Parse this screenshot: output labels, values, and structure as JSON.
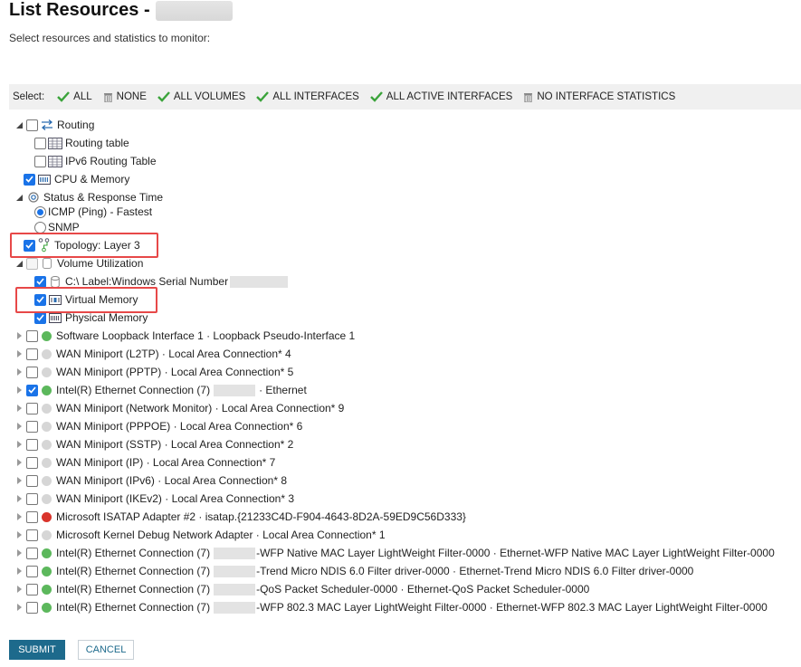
{
  "header": {
    "title": "List Resources -",
    "subtitle": "Select resources and statistics to monitor:"
  },
  "select_bar": {
    "label": "Select:",
    "buttons": [
      {
        "label": "ALL",
        "icon": "check-icon"
      },
      {
        "label": "NONE",
        "icon": "trash-icon"
      },
      {
        "label": "ALL VOLUMES",
        "icon": "check-icon"
      },
      {
        "label": "ALL INTERFACES",
        "icon": "check-icon"
      },
      {
        "label": "ALL ACTIVE INTERFACES",
        "icon": "check-icon"
      },
      {
        "label": "NO INTERFACE STATISTICS",
        "icon": "trash-icon"
      }
    ]
  },
  "tree": {
    "routing": {
      "label": "Routing",
      "checked": false
    },
    "routing_table": {
      "label": "Routing table",
      "checked": false
    },
    "ipv6_routing_table": {
      "label": "IPv6 Routing Table",
      "checked": false
    },
    "cpu_memory": {
      "label": "CPU & Memory",
      "checked": true
    },
    "status_response": {
      "label": "Status & Response Time"
    },
    "icmp": {
      "label": "ICMP (Ping) - Fastest",
      "selected": true
    },
    "snmp": {
      "label": "SNMP",
      "selected": false
    },
    "topology": {
      "label": "Topology: Layer 3",
      "checked": true
    },
    "volume_utilization": {
      "label": "Volume Utilization",
      "checked": false
    },
    "c_drive": {
      "label": "C:\\ Label:Windows Serial Number",
      "checked": true
    },
    "virtual_memory": {
      "label": "Virtual Memory",
      "checked": true
    },
    "physical_memory": {
      "label": "Physical Memory",
      "checked": true
    },
    "interfaces": [
      {
        "label": "Software Loopback Interface 1 · Loopback Pseudo-Interface 1",
        "status": "green",
        "checked": false
      },
      {
        "label": "WAN Miniport (L2TP) · Local Area Connection* 4",
        "status": "grey",
        "checked": false
      },
      {
        "label": "WAN Miniport (PPTP) · Local Area Connection* 5",
        "status": "grey",
        "checked": false
      },
      {
        "label": "Intel(R) Ethernet Connection (7)",
        "suffix": "· Ethernet",
        "status": "green",
        "checked": true,
        "redacted": true
      },
      {
        "label": "WAN Miniport (Network Monitor) · Local Area Connection* 9",
        "status": "grey",
        "checked": false
      },
      {
        "label": "WAN Miniport (PPPOE) · Local Area Connection* 6",
        "status": "grey",
        "checked": false
      },
      {
        "label": "WAN Miniport (SSTP) · Local Area Connection* 2",
        "status": "grey",
        "checked": false
      },
      {
        "label": "WAN Miniport (IP) · Local Area Connection* 7",
        "status": "grey",
        "checked": false
      },
      {
        "label": "WAN Miniport (IPv6) · Local Area Connection* 8",
        "status": "grey",
        "checked": false
      },
      {
        "label": "WAN Miniport (IKEv2) · Local Area Connection* 3",
        "status": "grey",
        "checked": false
      },
      {
        "label": "Microsoft ISATAP Adapter #2 · isatap.{21233C4D-F904-4643-8D2A-59ED9C56D333}",
        "status": "red",
        "checked": false
      },
      {
        "label": "Microsoft Kernel Debug Network Adapter · Local Area Connection* 1",
        "status": "grey",
        "checked": false
      },
      {
        "label": "Intel(R) Ethernet Connection (7)",
        "suffix": "-WFP Native MAC Layer LightWeight Filter-0000 · Ethernet-WFP Native MAC Layer LightWeight Filter-0000",
        "status": "green",
        "checked": false,
        "redacted": true
      },
      {
        "label": "Intel(R) Ethernet Connection (7)",
        "suffix": "-Trend Micro NDIS 6.0 Filter driver-0000 · Ethernet-Trend Micro NDIS 6.0 Filter driver-0000",
        "status": "green",
        "checked": false,
        "redacted": true
      },
      {
        "label": "Intel(R) Ethernet Connection (7)",
        "suffix": "-QoS Packet Scheduler-0000 · Ethernet-QoS Packet Scheduler-0000",
        "status": "green",
        "checked": false,
        "redacted": true
      },
      {
        "label": "Intel(R) Ethernet Connection (7)",
        "suffix": "-WFP 802.3 MAC Layer LightWeight Filter-0000 · Ethernet-WFP 802.3 MAC Layer LightWeight Filter-0000",
        "status": "green",
        "checked": false,
        "redacted": true
      }
    ]
  },
  "actions": {
    "submit": "SUBMIT",
    "cancel": "CANCEL"
  },
  "colors": {
    "accent": "#1a73e8",
    "submit_bg": "#1d6a8c",
    "highlight": "#e74848",
    "status_up": "#5cb85c",
    "status_unknown": "#d6d6d6",
    "status_down": "#d9342b"
  }
}
